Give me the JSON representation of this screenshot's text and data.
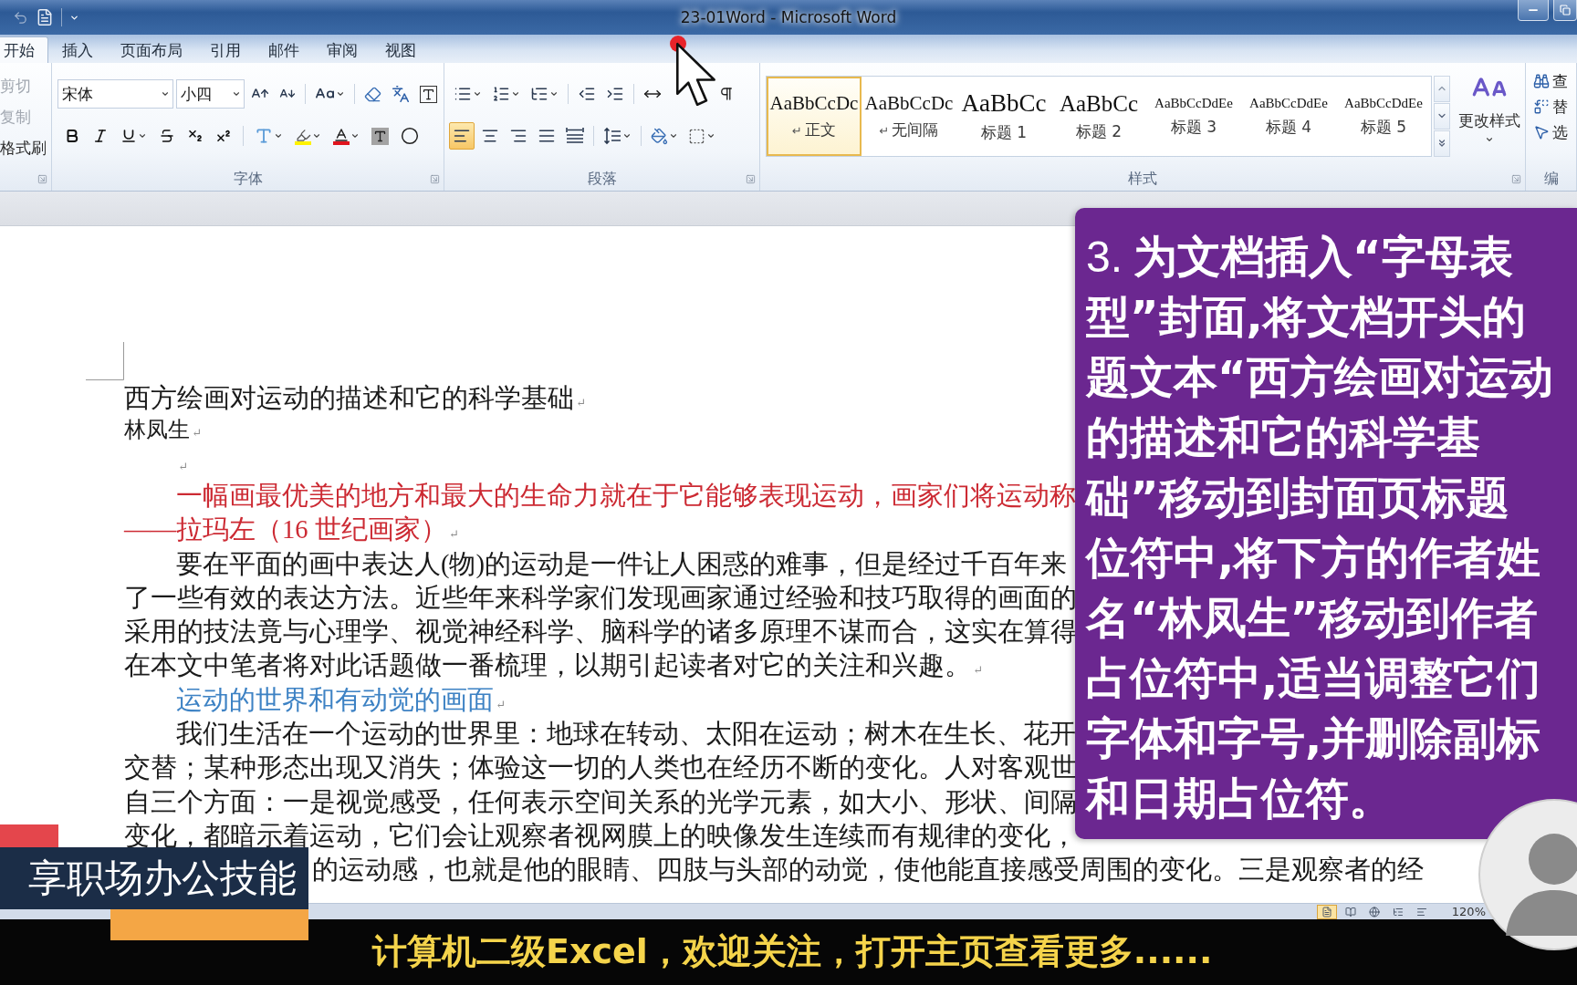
{
  "window": {
    "title": "23-01Word - Microsoft Word"
  },
  "tabs": [
    {
      "label": "开始",
      "selected": true
    },
    {
      "label": "插入",
      "selected": false
    },
    {
      "label": "页面布局",
      "selected": false
    },
    {
      "label": "引用",
      "selected": false
    },
    {
      "label": "邮件",
      "selected": false
    },
    {
      "label": "审阅",
      "selected": false
    },
    {
      "label": "视图",
      "selected": false
    }
  ],
  "ribbon": {
    "clipboard": {
      "items": [
        {
          "label": "剪切",
          "disabled": true
        },
        {
          "label": "复制",
          "disabled": true
        },
        {
          "label": "格式刷",
          "disabled": false
        }
      ]
    },
    "font": {
      "name": "宋体",
      "size": "小四",
      "label": "字体"
    },
    "paragraph": {
      "alignment": [
        {
          "kind": "left",
          "selected": true
        },
        {
          "kind": "center",
          "selected": false
        },
        {
          "kind": "right",
          "selected": false
        },
        {
          "kind": "justify",
          "selected": false
        },
        {
          "kind": "distributed",
          "selected": false
        }
      ],
      "label": "段落"
    },
    "styles": {
      "items": [
        {
          "kind": "body",
          "preview": "AaBbCcDc",
          "mark": "↵",
          "label": "正文",
          "selected": true
        },
        {
          "kind": "body",
          "preview": "AaBbCcDc",
          "mark": "↵",
          "label": "无间隔",
          "selected": false
        },
        {
          "kind": "heading-large",
          "preview": "AaBbCc",
          "label": "标题 1",
          "selected": false
        },
        {
          "kind": "heading-medium",
          "preview": "AaBbCc",
          "label": "标题 2",
          "selected": false
        },
        {
          "kind": "heading-small",
          "preview": "AaBbCcDdEe",
          "label": "标题 3",
          "selected": false
        },
        {
          "kind": "heading-small",
          "preview": "AaBbCcDdEe",
          "label": "标题 4",
          "selected": false
        },
        {
          "kind": "heading-small",
          "preview": "AaBbCcDdEe",
          "label": "标题 5",
          "selected": false
        }
      ],
      "change_styles": "更改样式",
      "label": "样式"
    },
    "editing": {
      "items": [
        {
          "kind": "find",
          "label": "查"
        },
        {
          "kind": "replace",
          "label": "替"
        },
        {
          "kind": "select",
          "label": "选"
        }
      ],
      "label": "编"
    }
  },
  "document": {
    "paragraphs": [
      {
        "kind": "title",
        "lines": [
          "西方绘画对运动的描述和它的科学基础"
        ],
        "mark": "↵"
      },
      {
        "kind": "author",
        "lines": [
          "林凤生"
        ],
        "mark": "↵"
      },
      {
        "kind": "empty",
        "mark": "↵"
      },
      {
        "kind": "quote",
        "lines": [
          "一幅画最优美的地方和最大的生命力就在于它能够表现运动，画家们将运动称",
          "——拉玛左（16 世纪画家）"
        ],
        "mark": "↵"
      },
      {
        "kind": "body",
        "lines": [
          "要在平面的画中表达人(物)的运动是一件让人困惑的难事，但是经过千百年来",
          "了一些有效的表达方法。近些年来科学家们发现画家通过经验和技巧取得的画面的",
          "采用的技法竟与心理学、视觉神经科学、脑科学的诸多原理不谋而合，这实在算得",
          "在本文中笔者将对此话题做一番梳理，以期引起读者对它的关注和兴趣。"
        ],
        "mark": "↵"
      },
      {
        "kind": "heading",
        "lines": [
          "运动的世界和有动觉的画面"
        ],
        "mark": "↵"
      },
      {
        "kind": "body",
        "lines": [
          "我们生活在一个运动的世界里：地球在转动、太阳在运动；树木在生长、花开",
          "交替；某种形态出现又消失；体验这一切的人类也在经历不断的变化。人对客观世",
          "自三个方面：一是视觉感受，任何表示空间关系的光学元素，如大小、形状、间隔",
          "变化，都暗示着运动，它们会让观察者视网膜上的映像发生连续而有规律的变化，"
        ]
      },
      {
        "kind": "hidden-start",
        "lines": [
          "的运动感，也就是他的眼睛、四肢与头部的动觉，使他能直接感受周围的变化。三是观察者的经"
        ]
      }
    ]
  },
  "instruction": {
    "number": "3.",
    "lines": [
      "为文档插入“字母表",
      "型”封面,将文档开头的",
      "题文本“西方绘画对运动",
      "的描述和它的科学基",
      "础”移动到封面页标题",
      "位符中,将下方的作者姓",
      "名“林凤生”移动到作者",
      "占位符中,适当调整它们",
      "字体和字号,并删除副标",
      "和日期占位符。"
    ]
  },
  "status_bar": {
    "views": [
      {
        "kind": "print",
        "selected": true
      },
      {
        "kind": "reading",
        "selected": false
      },
      {
        "kind": "web",
        "selected": false
      },
      {
        "kind": "outline",
        "selected": false
      },
      {
        "kind": "draft",
        "selected": false
      }
    ],
    "zoom": "120%"
  },
  "overlays": {
    "banner": "享职场办公技能",
    "subtitle": "计算机二级Excel，欢迎关注，打开主页查看更多......"
  }
}
